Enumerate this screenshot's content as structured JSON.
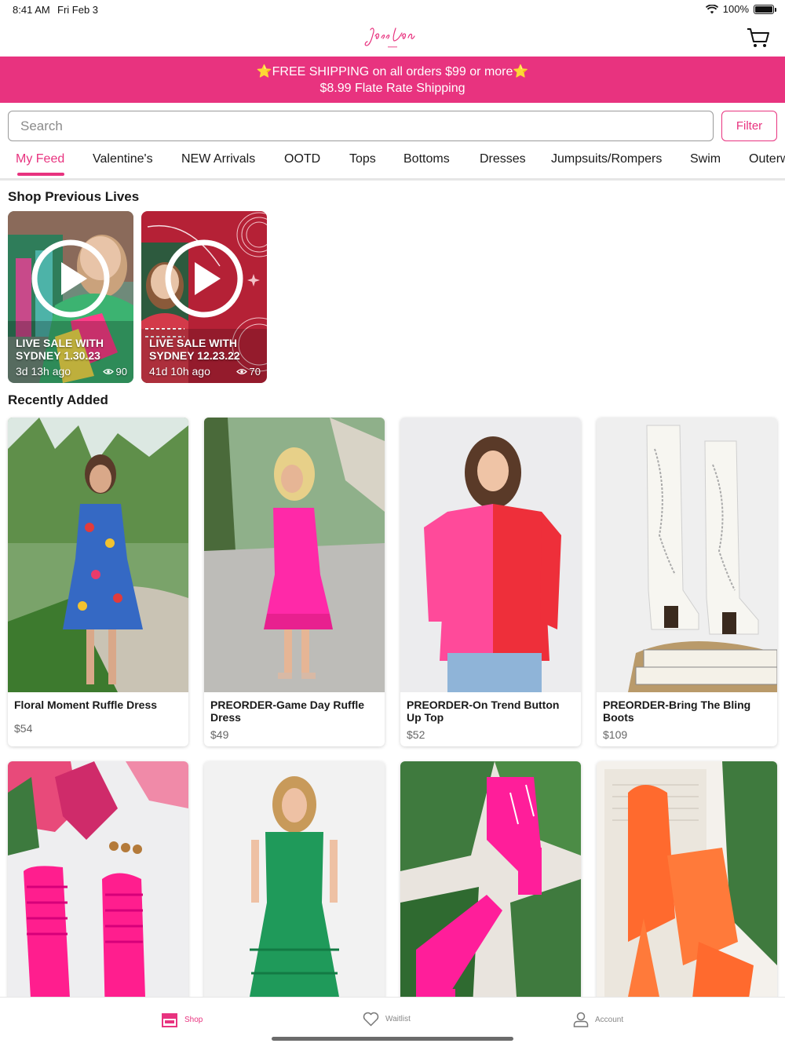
{
  "status_bar": {
    "time": "8:41 AM",
    "date": "Fri Feb 3",
    "battery": "100%",
    "battery_level": 1.0
  },
  "header": {
    "logo_text": "Jess Lea",
    "cart_icon": "cart-icon"
  },
  "promo": {
    "line1_star": "⭐",
    "line1": "FREE SHIPPING on all orders $99 or more",
    "line2": "$8.99 Flate Rate Shipping"
  },
  "search": {
    "placeholder": "Search",
    "filter_label": "Filter"
  },
  "tabs": [
    {
      "label": "My Feed",
      "active": true
    },
    {
      "label": "Valentine's"
    },
    {
      "label": "NEW Arrivals"
    },
    {
      "label": "OOTD"
    },
    {
      "label": "Tops"
    },
    {
      "label": "Bottoms"
    },
    {
      "label": "Dresses"
    },
    {
      "label": "Jumpsuits/Rompers"
    },
    {
      "label": "Swim"
    },
    {
      "label": "Outerw"
    }
  ],
  "previous_lives": {
    "title": "Shop Previous Lives",
    "items": [
      {
        "title": "LIVE SALE WITH SYDNEY 1.30.23",
        "age": "3d 13h ago",
        "views": "90"
      },
      {
        "title": "LIVE SALE WITH SYDNEY 12.23.22",
        "age": "41d 10h ago",
        "views": "70"
      }
    ]
  },
  "recently_added": {
    "title": "Recently Added",
    "products": [
      {
        "name": "Floral Moment Ruffle Dress",
        "price": "$54"
      },
      {
        "name": "PREORDER-Game Day Ruffle Dress",
        "price": "$49"
      },
      {
        "name": "PREORDER-On Trend Button Up Top",
        "price": "$52"
      },
      {
        "name": "PREORDER-Bring The Bling Boots",
        "price": "$109"
      },
      {
        "name": "",
        "price": ""
      },
      {
        "name": "",
        "price": ""
      },
      {
        "name": "",
        "price": ""
      },
      {
        "name": "",
        "price": ""
      }
    ]
  },
  "tab_bar": {
    "shop": "Shop",
    "waitlist": "Waitlist",
    "account": "Account"
  },
  "colors": {
    "brand": "#e8337f",
    "text": "#1a1a1a"
  }
}
